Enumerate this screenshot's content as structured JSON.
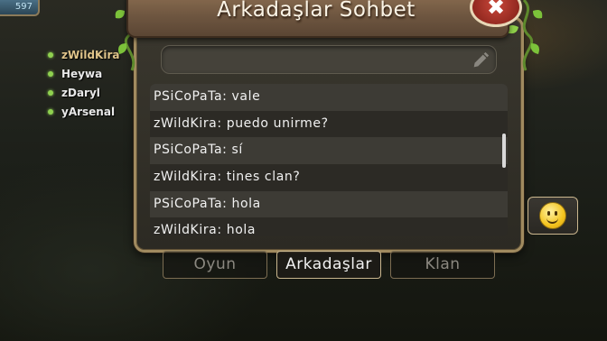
{
  "hud": {
    "value": "597"
  },
  "friends": [
    {
      "name": "zWildKira",
      "active": true
    },
    {
      "name": "Heywa"
    },
    {
      "name": "zDaryl"
    },
    {
      "name": "yArsenal"
    }
  ],
  "window": {
    "title": "Arkadaşlar Sohbet"
  },
  "chat": {
    "input_value": "",
    "messages": [
      "PSiCoPaTa: vale",
      "zWildKira: puedo unirme?",
      "PSiCoPaTa: sí",
      "zWildKira: tines clan?",
      "PSiCoPaTa: hola",
      "zWildKira: hola"
    ]
  },
  "tabs": [
    {
      "label": "Oyun"
    },
    {
      "label": "Arkadaşlar",
      "active": true
    },
    {
      "label": "Klan"
    }
  ],
  "icons": {
    "close": "close-icon",
    "edit": "pencil-icon",
    "emoji": "smiley-icon"
  },
  "colors": {
    "panel_border": "#a08a5f",
    "title_board": "#6e5640",
    "online_dot": "#8fd14f",
    "close_button": "#c9473a"
  }
}
